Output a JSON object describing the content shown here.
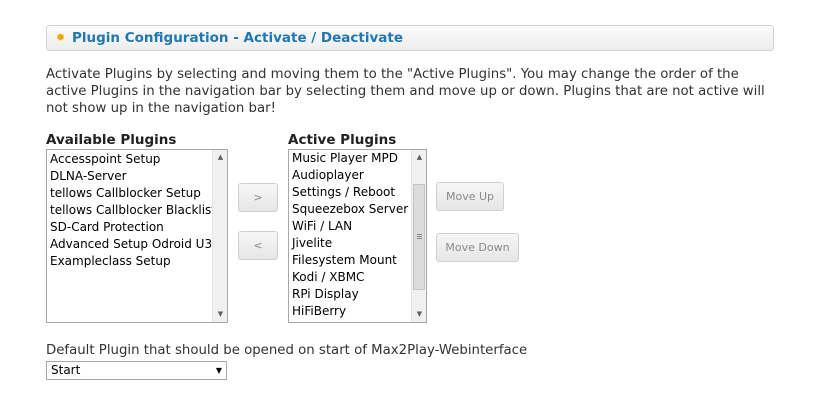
{
  "header": {
    "icon": "gear-icon",
    "title": "Plugin Configuration - Activate / Deactivate"
  },
  "description": "Activate Plugins by selecting and moving them to the \"Active Plugins\". You may change the order of the active Plugins in the navigation bar by selecting them and move up or down. Plugins that are not active will not show up in the navigation bar!",
  "available": {
    "label": "Available Plugins",
    "items": [
      "Accesspoint Setup",
      "DLNA-Server",
      "tellows Callblocker Setup",
      "tellows Callblocker Blacklist",
      "SD-Card Protection",
      "Advanced Setup Odroid U3",
      "Exampleclass Setup"
    ]
  },
  "active": {
    "label": "Active Plugins",
    "items": [
      "Music Player MPD",
      "Audioplayer",
      "Settings / Reboot",
      "Squeezebox Server",
      "WiFi / LAN",
      "Jivelite",
      "Filesystem Mount",
      "Kodi / XBMC",
      "RPi Display",
      "HiFiBerry"
    ]
  },
  "buttons": {
    "move_right": ">",
    "move_left": "<",
    "move_up": "Move Up",
    "move_down": "Move Down"
  },
  "default_plugin": {
    "label": "Default Plugin that should be opened on start of Max2Play-Webinterface",
    "selected": "Start"
  }
}
